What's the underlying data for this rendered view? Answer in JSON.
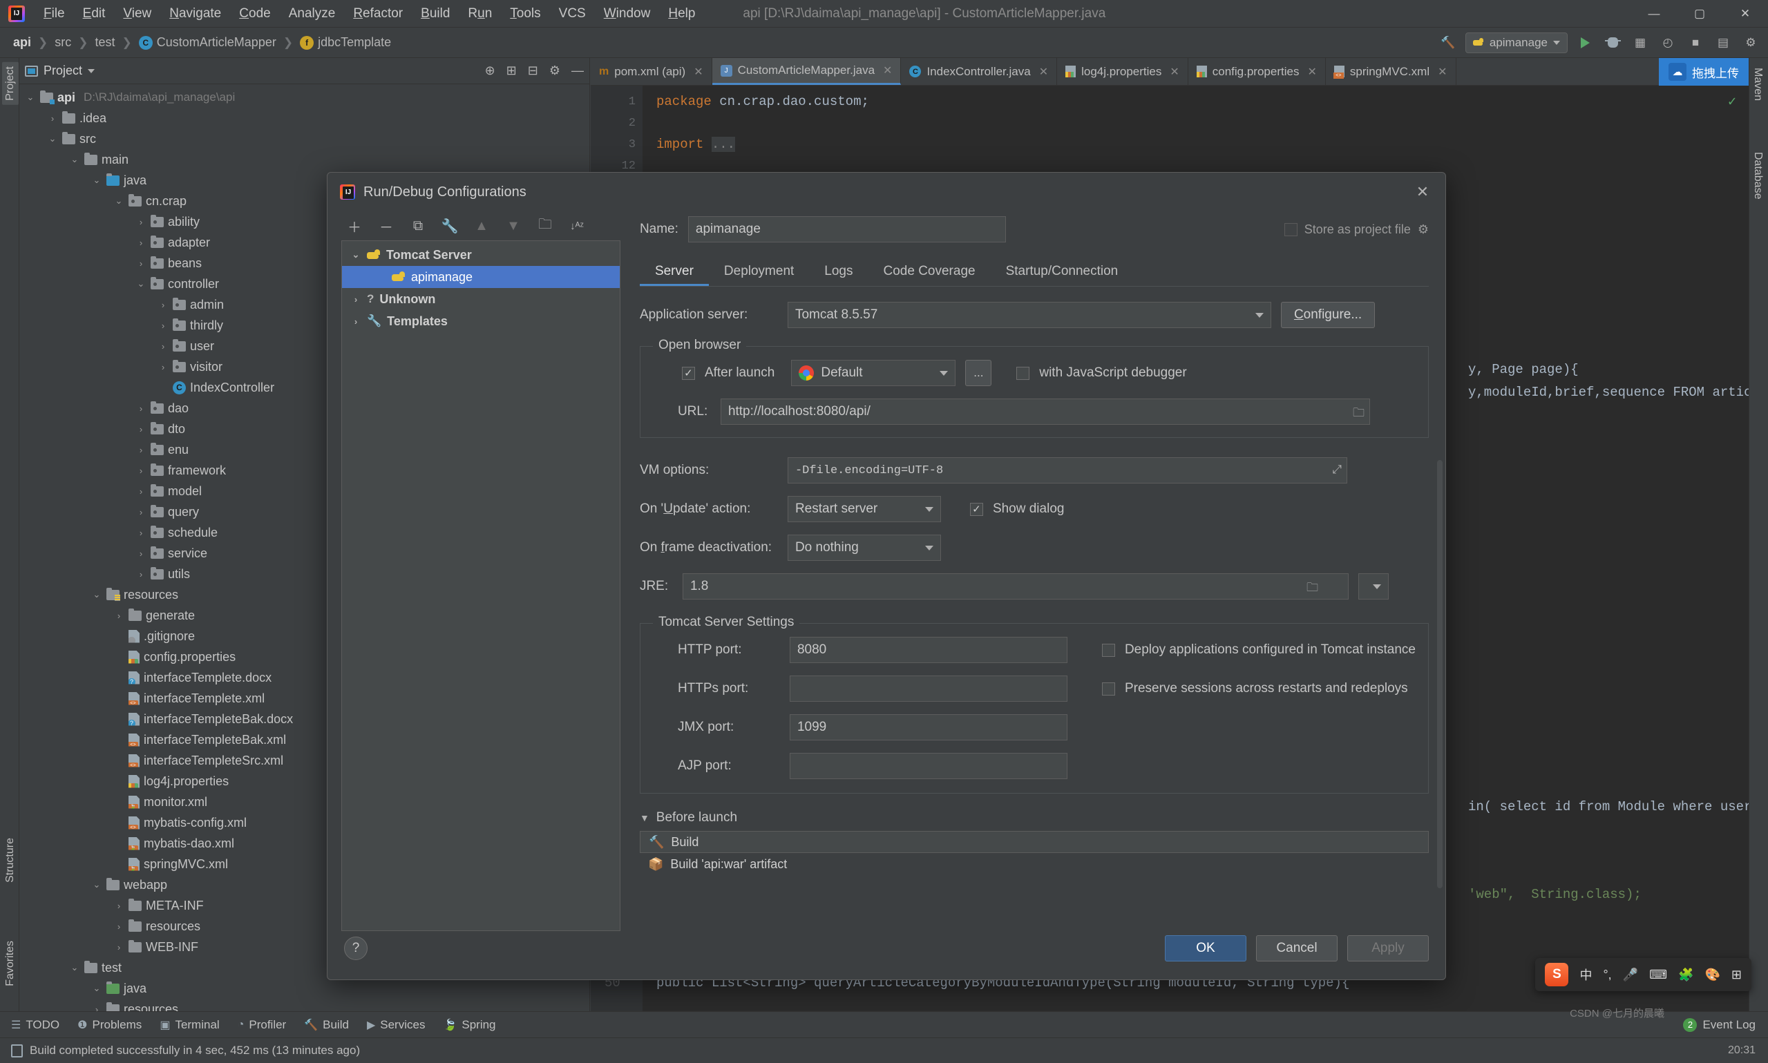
{
  "titlebar": {
    "menus": [
      "File",
      "Edit",
      "View",
      "Navigate",
      "Code",
      "Analyze",
      "Refactor",
      "Build",
      "Run",
      "Tools",
      "VCS",
      "Window",
      "Help"
    ],
    "window_title": "api [D:\\RJ\\daima\\api_manage\\api] - CustomArticleMapper.java",
    "minimize": "—",
    "maximize": "▢",
    "close": "✕"
  },
  "navbar": {
    "crumbs": [
      "api",
      "src",
      "test",
      "CustomArticleMapper",
      "jdbcTemplate"
    ],
    "class_badge": "C",
    "field_badge": "f",
    "run_config": "apimanage",
    "search_icon": "search-icon",
    "run_icon": "run-icon",
    "debug_icon": "debug-icon",
    "coverage_icon": "coverage-icon",
    "profiler_icon": "profiler-icon",
    "stop_icon": "stop-icon",
    "layout_icon": "layout-icon",
    "settings_icon": "settings-icon"
  },
  "left_strip": {
    "tabs": [
      "Project",
      "Structure",
      "Favorites"
    ]
  },
  "right_strip": {
    "tabs": [
      "Maven",
      "Database"
    ]
  },
  "project_panel": {
    "title": "Project",
    "tree": [
      {
        "indent": 0,
        "tw": "v",
        "icon": "module-folder",
        "label": "api",
        "bold": true,
        "path": "D:\\RJ\\daima\\api_manage\\api"
      },
      {
        "indent": 1,
        "tw": ">",
        "icon": "folder",
        "label": ".idea"
      },
      {
        "indent": 1,
        "tw": "v",
        "icon": "folder",
        "label": "src"
      },
      {
        "indent": 2,
        "tw": "v",
        "icon": "folder",
        "label": "main"
      },
      {
        "indent": 3,
        "tw": "v",
        "icon": "source-folder",
        "label": "java"
      },
      {
        "indent": 4,
        "tw": "v",
        "icon": "package",
        "label": "cn.crap"
      },
      {
        "indent": 5,
        "tw": ">",
        "icon": "package",
        "label": "ability"
      },
      {
        "indent": 5,
        "tw": ">",
        "icon": "package",
        "label": "adapter"
      },
      {
        "indent": 5,
        "tw": ">",
        "icon": "package",
        "label": "beans"
      },
      {
        "indent": 5,
        "tw": "v",
        "icon": "package",
        "label": "controller"
      },
      {
        "indent": 6,
        "tw": ">",
        "icon": "package",
        "label": "admin"
      },
      {
        "indent": 6,
        "tw": ">",
        "icon": "package",
        "label": "thirdly"
      },
      {
        "indent": 6,
        "tw": ">",
        "icon": "package",
        "label": "user"
      },
      {
        "indent": 6,
        "tw": ">",
        "icon": "package",
        "label": "visitor"
      },
      {
        "indent": 6,
        "tw": "",
        "icon": "class",
        "label": "IndexController"
      },
      {
        "indent": 5,
        "tw": ">",
        "icon": "package",
        "label": "dao"
      },
      {
        "indent": 5,
        "tw": ">",
        "icon": "package",
        "label": "dto"
      },
      {
        "indent": 5,
        "tw": ">",
        "icon": "package",
        "label": "enu"
      },
      {
        "indent": 5,
        "tw": ">",
        "icon": "package",
        "label": "framework"
      },
      {
        "indent": 5,
        "tw": ">",
        "icon": "package",
        "label": "model"
      },
      {
        "indent": 5,
        "tw": ">",
        "icon": "package",
        "label": "query"
      },
      {
        "indent": 5,
        "tw": ">",
        "icon": "package",
        "label": "schedule"
      },
      {
        "indent": 5,
        "tw": ">",
        "icon": "package",
        "label": "service"
      },
      {
        "indent": 5,
        "tw": ">",
        "icon": "package",
        "label": "utils"
      },
      {
        "indent": 3,
        "tw": "v",
        "icon": "resource-folder",
        "label": "resources"
      },
      {
        "indent": 4,
        "tw": ">",
        "icon": "folder",
        "label": "generate"
      },
      {
        "indent": 4,
        "tw": "",
        "icon": "file-ignore",
        "label": ".gitignore"
      },
      {
        "indent": 4,
        "tw": "",
        "icon": "file-properties",
        "label": "config.properties"
      },
      {
        "indent": 4,
        "tw": "",
        "icon": "file-unknown",
        "label": "interfaceTemplete.docx"
      },
      {
        "indent": 4,
        "tw": "",
        "icon": "file-xml",
        "label": "interfaceTemplete.xml"
      },
      {
        "indent": 4,
        "tw": "",
        "icon": "file-unknown",
        "label": "interfaceTempleteBak.docx"
      },
      {
        "indent": 4,
        "tw": "",
        "icon": "file-xml",
        "label": "interfaceTempleteBak.xml"
      },
      {
        "indent": 4,
        "tw": "",
        "icon": "file-xml",
        "label": "interfaceTempleteSrc.xml"
      },
      {
        "indent": 4,
        "tw": "",
        "icon": "file-properties",
        "label": "log4j.properties"
      },
      {
        "indent": 4,
        "tw": "",
        "icon": "file-spring",
        "label": "monitor.xml"
      },
      {
        "indent": 4,
        "tw": "",
        "icon": "file-xml",
        "label": "mybatis-config.xml"
      },
      {
        "indent": 4,
        "tw": "",
        "icon": "file-spring",
        "label": "mybatis-dao.xml"
      },
      {
        "indent": 4,
        "tw": "",
        "icon": "file-spring",
        "label": "springMVC.xml"
      },
      {
        "indent": 3,
        "tw": "v",
        "icon": "folder",
        "label": "webapp"
      },
      {
        "indent": 4,
        "tw": ">",
        "icon": "folder",
        "label": "META-INF"
      },
      {
        "indent": 4,
        "tw": ">",
        "icon": "folder",
        "label": "resources"
      },
      {
        "indent": 4,
        "tw": ">",
        "icon": "folder",
        "label": "WEB-INF"
      },
      {
        "indent": 2,
        "tw": "v",
        "icon": "folder",
        "label": "test"
      },
      {
        "indent": 3,
        "tw": "v",
        "icon": "test-folder",
        "label": "java"
      },
      {
        "indent": 3,
        "tw": ">",
        "icon": "folder",
        "label": "resources"
      }
    ]
  },
  "editor": {
    "tabs": [
      {
        "icon": "maven-icon",
        "label": "pom.xml (api)",
        "active": false
      },
      {
        "icon": "java-icon",
        "label": "CustomArticleMapper.java",
        "active": true
      },
      {
        "icon": "class-icon",
        "label": "IndexController.java",
        "active": false
      },
      {
        "icon": "properties-icon",
        "label": "log4j.properties",
        "active": false
      },
      {
        "icon": "properties-icon",
        "label": "config.properties",
        "active": false
      },
      {
        "icon": "xml-icon",
        "label": "springMVC.xml",
        "active": false
      }
    ],
    "upload_button": "拖拽上传",
    "gutter": [
      "1",
      "2",
      "3",
      "12"
    ],
    "code_lines": [
      "package cn.crap.dao.custom;",
      "",
      "import ...",
      ""
    ],
    "fragments": [
      "y, Page page){",
      "y,moduleId,brief,sequence FROM articl",
      "in( select id from Module where user)",
      "'web\",  String.class);",
      "public List<String> queryArticleCategoryByModuleIdAndType(String moduleId, String type){"
    ],
    "line_number_bottom": "50",
    "inspection_status": "✓"
  },
  "dialog": {
    "title": "Run/Debug Configurations",
    "close_label": "✕",
    "toolbar_icons": [
      "add-icon",
      "remove-icon",
      "copy-icon",
      "edit-templates-icon",
      "move-up-icon",
      "move-down-icon",
      "new-folder-icon",
      "sort-icon"
    ],
    "toolbar_glyphs": [
      "＋",
      "－",
      "⧉",
      "🔧",
      "▲",
      "▼",
      "🗀",
      "↓ᴬᶻ"
    ],
    "config_tree": [
      {
        "tw": "v",
        "icon": "tomcat-icon",
        "label": "Tomcat Server",
        "bold": true,
        "selected": false,
        "indent": 0
      },
      {
        "tw": "",
        "icon": "tomcat-icon",
        "label": "apimanage",
        "bold": false,
        "selected": true,
        "indent": 1
      },
      {
        "tw": ">",
        "icon": "question-icon",
        "label": "Unknown",
        "bold": true,
        "selected": false,
        "indent": 0
      },
      {
        "tw": ">",
        "icon": "wrench-icon",
        "label": "Templates",
        "bold": true,
        "selected": false,
        "indent": 0
      }
    ],
    "name_label": "Name:",
    "name_value": "apimanage",
    "store_as_project_file": "Store as project file",
    "store_checked": false,
    "gear_icon": "gear-icon",
    "tabs": [
      {
        "label": "Server",
        "active": true
      },
      {
        "label": "Deployment",
        "active": false
      },
      {
        "label": "Logs",
        "active": false
      },
      {
        "label": "Code Coverage",
        "active": false
      },
      {
        "label": "Startup/Connection",
        "active": false
      }
    ],
    "application_server_label": "Application server:",
    "application_server_value": "Tomcat 8.5.57",
    "configure_button": "Configure...",
    "open_browser_group": "Open browser",
    "after_launch_label": "After launch",
    "after_launch_checked": true,
    "browser_value": "Default",
    "browser_icon": "chrome-icon",
    "ellipsis_button": "...",
    "js_debugger_label": "with JavaScript debugger",
    "js_debugger_checked": false,
    "url_label": "URL:",
    "url_value": "http://localhost:8080/api/",
    "vm_options_label": "VM options:",
    "vm_options_value": "-Dfile.encoding=UTF-8",
    "vm_expand_icon": "expand-icon",
    "on_update_label": "On 'Update' action:",
    "on_update_value": "Restart server",
    "show_dialog_label": "Show dialog",
    "show_dialog_checked": true,
    "on_frame_deactivation_label": "On frame deactivation:",
    "on_frame_deactivation_value": "Do nothing",
    "jre_label": "JRE:",
    "jre_value": "1.8",
    "tomcat_settings_group": "Tomcat Server Settings",
    "http_port_label": "HTTP port:",
    "http_port_value": "8080",
    "https_port_label": "HTTPs port:",
    "https_port_value": "",
    "jmx_port_label": "JMX port:",
    "jmx_port_value": "1099",
    "ajp_port_label": "AJP port:",
    "ajp_port_value": "",
    "deploy_apps_label": "Deploy applications configured in Tomcat instance",
    "deploy_apps_checked": false,
    "preserve_sessions_label": "Preserve sessions across restarts and redeploys",
    "preserve_sessions_checked": false,
    "before_launch_label": "Before launch",
    "before_launch_items": [
      {
        "icon": "hammer-icon",
        "label": "Build"
      },
      {
        "icon": "artifact-icon",
        "label": "Build 'api:war' artifact"
      }
    ],
    "help_button": "?",
    "ok_button": "OK",
    "cancel_button": "Cancel",
    "apply_button": "Apply"
  },
  "toolwindow_bar": {
    "items": [
      {
        "icon": "todo-icon",
        "label": "TODO"
      },
      {
        "icon": "problems-icon",
        "label": "Problems"
      },
      {
        "icon": "terminal-icon",
        "label": "Terminal"
      },
      {
        "icon": "profiler-icon",
        "label": "Profiler"
      },
      {
        "icon": "build-icon",
        "label": "Build"
      },
      {
        "icon": "services-icon",
        "label": "Services"
      },
      {
        "icon": "spring-icon",
        "label": "Spring"
      }
    ],
    "event_log_label": "Event Log",
    "event_log_count": "2"
  },
  "statusbar": {
    "message": "Build completed successfully in 4 sec, 452 ms (13 minutes ago)",
    "time": "20:31"
  },
  "ime_bar": {
    "logo": "S",
    "items": [
      "中",
      "°,",
      "🎤",
      "⌨",
      "🧩",
      "🎨",
      "⊞"
    ]
  },
  "watermark": "CSDN @七月的晨曦"
}
